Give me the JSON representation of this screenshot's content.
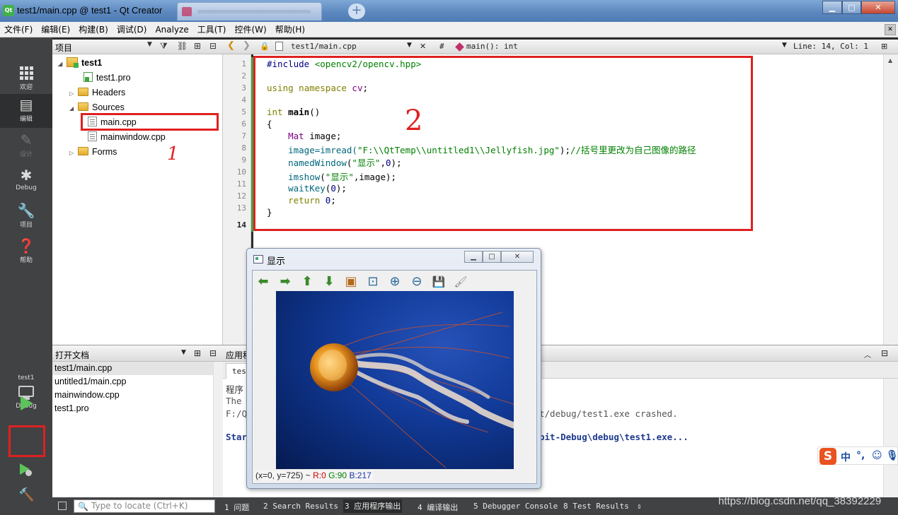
{
  "window": {
    "title": "test1/main.cpp @ test1 - Qt Creator",
    "app_icon_text": "Qt",
    "controls": {
      "minimize": "▁",
      "maximize": "□",
      "close": "✕"
    },
    "new_tab_glyph": "+"
  },
  "menu": [
    "文件(F)",
    "编辑(E)",
    "构建(B)",
    "调试(D)",
    "Analyze",
    "工具(T)",
    "控件(W)",
    "帮助(H)"
  ],
  "modes": [
    {
      "label": "欢迎",
      "icon": "grid-icon"
    },
    {
      "label": "编辑",
      "icon": "edit-icon",
      "selected": true
    },
    {
      "label": "设计",
      "icon": "design-icon",
      "disabled": true
    },
    {
      "label": "Debug",
      "icon": "bug-icon"
    },
    {
      "label": "项目",
      "icon": "wrench-icon"
    },
    {
      "label": "帮助",
      "icon": "help-icon"
    }
  ],
  "kit": {
    "project": "test1",
    "config": "Debug"
  },
  "project_pane": {
    "header": "项目",
    "tree": {
      "root": "test1",
      "pro_file": "test1.pro",
      "headers": "Headers",
      "sources": "Sources",
      "main_cpp": "main.cpp",
      "mainwindow_cpp": "mainwindow.cpp",
      "forms": "Forms"
    }
  },
  "open_docs": {
    "header": "打开文档",
    "items": [
      "test1/main.cpp",
      "untitled1/main.cpp",
      "mainwindow.cpp",
      "test1.pro"
    ]
  },
  "editor_toolbar": {
    "file": "test1/main.cpp",
    "hash": "#",
    "symbol": "main(): int",
    "position": "Line: 14, Col: 1"
  },
  "code": {
    "line_numbers": [
      "1",
      "2",
      "3",
      "4",
      "5",
      "6",
      "7",
      "8",
      "9",
      "10",
      "11",
      "12",
      "13",
      "14"
    ],
    "l1_directive": "#include",
    "l1_header": " <opencv2/opencv.hpp>",
    "l3_using": "using",
    "l3_namespace": " namespace",
    "l3_ns": " cv",
    "l3_semi": ";",
    "l5_type": "int",
    "l5_name": " main",
    "l5_paren": "()",
    "l6": "{",
    "l7_type": "    Mat",
    "l7_rest": " image;",
    "l8_call": "    image=imread(",
    "l8_str": "\"F:\\\\QtTemp\\\\untitled1\\\\Jellyfish.jpg\"",
    "l8_end": ");",
    "l8_comment": "//括号里更改为自己图像的路径",
    "l9_fn": "    namedWindow",
    "l9_open": "(",
    "l9_str": "\"显示\"",
    "l9_comma": ",",
    "l9_num": "0",
    "l9_end": ");",
    "l10_fn": "    imshow",
    "l10_open": "(",
    "l10_str": "\"显示\"",
    "l10_end": ",image);",
    "l11_fn": "    waitKey",
    "l11_open": "(",
    "l11_num": "0",
    "l11_end": ");",
    "l12_kw": "    return",
    "l12_num": " 0",
    "l12_end": ";",
    "l13": "}"
  },
  "annotations": {
    "one": "1",
    "two": "2",
    "three": "3"
  },
  "output_pane": {
    "header": "应用程",
    "tab": "test",
    "lines": [
      "程序",
      "The",
      "F:/Q",
      "t/debug/test1.exe crashed.",
      "Star",
      "bit-Debug\\debug\\test1.exe..."
    ]
  },
  "image_window": {
    "title": "显示",
    "toolbar_icons": [
      "arrow-left-icon",
      "arrow-right-icon",
      "arrow-up-icon",
      "arrow-down-icon",
      "image-icon",
      "zoom-fit-icon",
      "zoom-in-icon",
      "zoom-out-icon",
      "save-icon",
      "properties-icon"
    ],
    "toolbar_glyphs": [
      "⬅",
      "➡",
      "⬆",
      "⬇",
      "▣",
      "⊡",
      "⊕",
      "⊖",
      "💾",
      "🖌"
    ],
    "status": {
      "coords": "(x=0, y=725) ~",
      "r": "R:0",
      "g": "G:90",
      "b": "B:217"
    },
    "controls": {
      "minimize": "▁",
      "maximize": "□",
      "close": "✕"
    }
  },
  "locator": {
    "placeholder": "Type to locate (Ctrl+K)"
  },
  "status_tabs": [
    "1  问题",
    "2  Search Results",
    "3  应用程序输出",
    "4  编译输出",
    "5  Debugger Console",
    "8  Test Results"
  ],
  "status_more": "⇕",
  "watermark": "https://blog.csdn.net/qq_38392229",
  "ime": {
    "logo": "S",
    "mode": "中",
    "punct": "°,",
    "emoji": "☺",
    "mic": "🎙"
  }
}
